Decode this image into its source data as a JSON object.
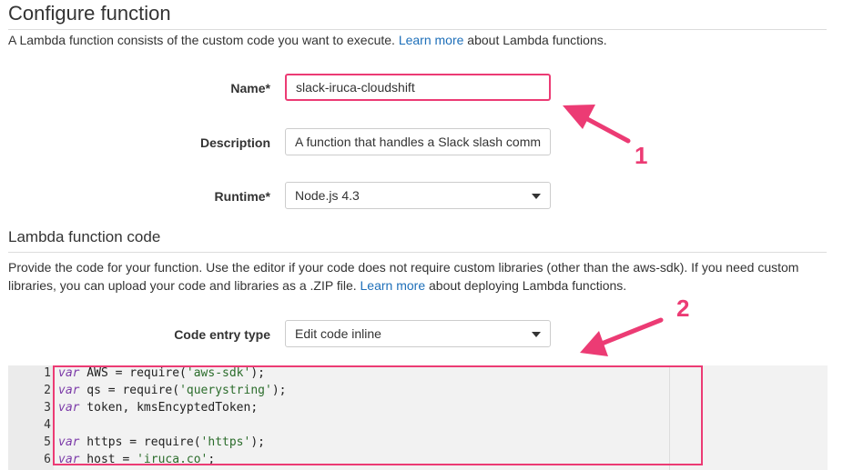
{
  "header": {
    "title": "Configure function",
    "intro_before": "A Lambda function consists of the custom code you want to execute. ",
    "intro_link": "Learn more",
    "intro_after": " about Lambda functions."
  },
  "form": {
    "name_label": "Name*",
    "name_value": "slack-iruca-cloudshift",
    "description_label": "Description",
    "description_value": "A function that handles a Slack slash comm",
    "runtime_label": "Runtime*",
    "runtime_value": "Node.js 4.3"
  },
  "code_section": {
    "title": "Lambda function code",
    "desc_line1": "Provide the code for your function. Use the editor if your code does not require custom libraries (other than the aws-sdk). If you need custom",
    "desc_line2_before": "libraries, you can upload your code and libraries as a .ZIP file. ",
    "desc_link": "Learn more",
    "desc_line2_after": " about deploying Lambda functions.",
    "entry_type_label": "Code entry type",
    "entry_type_value": "Edit code inline"
  },
  "editor": {
    "lines": [
      {
        "num": "1",
        "kw": "var",
        "rest_a": " AWS = require(",
        "str": "'aws-sdk'",
        "rest_b": ");"
      },
      {
        "num": "2",
        "kw": "var",
        "rest_a": " qs = require(",
        "str": "'querystring'",
        "rest_b": ");"
      },
      {
        "num": "3",
        "kw": "var",
        "rest_a": " token, kmsEncyptedToken;",
        "str": "",
        "rest_b": ""
      },
      {
        "num": "4",
        "kw": "",
        "rest_a": "",
        "str": "",
        "rest_b": ""
      },
      {
        "num": "5",
        "kw": "var",
        "rest_a": " https = require(",
        "str": "'https'",
        "rest_b": ");"
      },
      {
        "num": "6",
        "kw": "var",
        "rest_a": " host = ",
        "str": "'iruca.co'",
        "rest_b": ";"
      }
    ]
  },
  "annotations": {
    "marker_1": "1",
    "marker_2": "2",
    "accent_color": "#ec3b74"
  }
}
